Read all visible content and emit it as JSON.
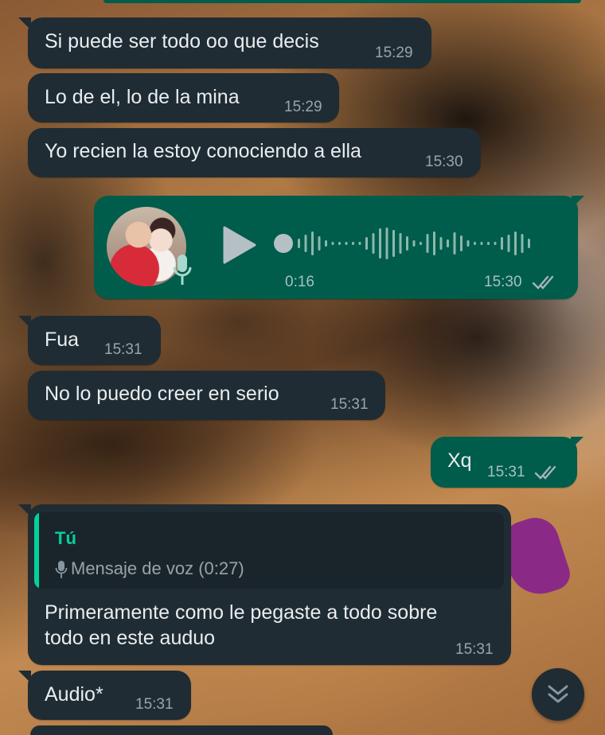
{
  "messages": [
    {
      "text": "Si puede ser todo oo que decis",
      "time": "15:29"
    },
    {
      "text": "Lo de el, lo de la mina",
      "time": "15:29"
    },
    {
      "text": "Yo recien la estoy conociendo a ella",
      "time": "15:30"
    },
    {
      "voice_duration": "0:16",
      "time": "15:30",
      "status": "read"
    },
    {
      "text": "Fua",
      "time": "15:31"
    },
    {
      "text": "No lo puedo creer en serio",
      "time": "15:31"
    },
    {
      "text": "Xq",
      "time": "15:31",
      "status": "read"
    },
    {
      "quoted_author": "Tú",
      "quoted_text": "Mensaje de voz (0:27)",
      "text_line1": "Primeramente como le pegaste a todo sobre",
      "text_line2": "todo en este auduo",
      "time": "15:31"
    },
    {
      "text": "Audio*",
      "time": "15:31"
    }
  ],
  "icons": {
    "play": "play-icon",
    "mic": "microphone-icon",
    "ticks": "double-check-icon",
    "scroll": "chevron-double-down-icon"
  },
  "colors": {
    "incoming_bubble": "#1f2c33",
    "outgoing_bubble": "#005c4b",
    "quote_accent": "#06cf9c"
  },
  "voice_progress": 0
}
